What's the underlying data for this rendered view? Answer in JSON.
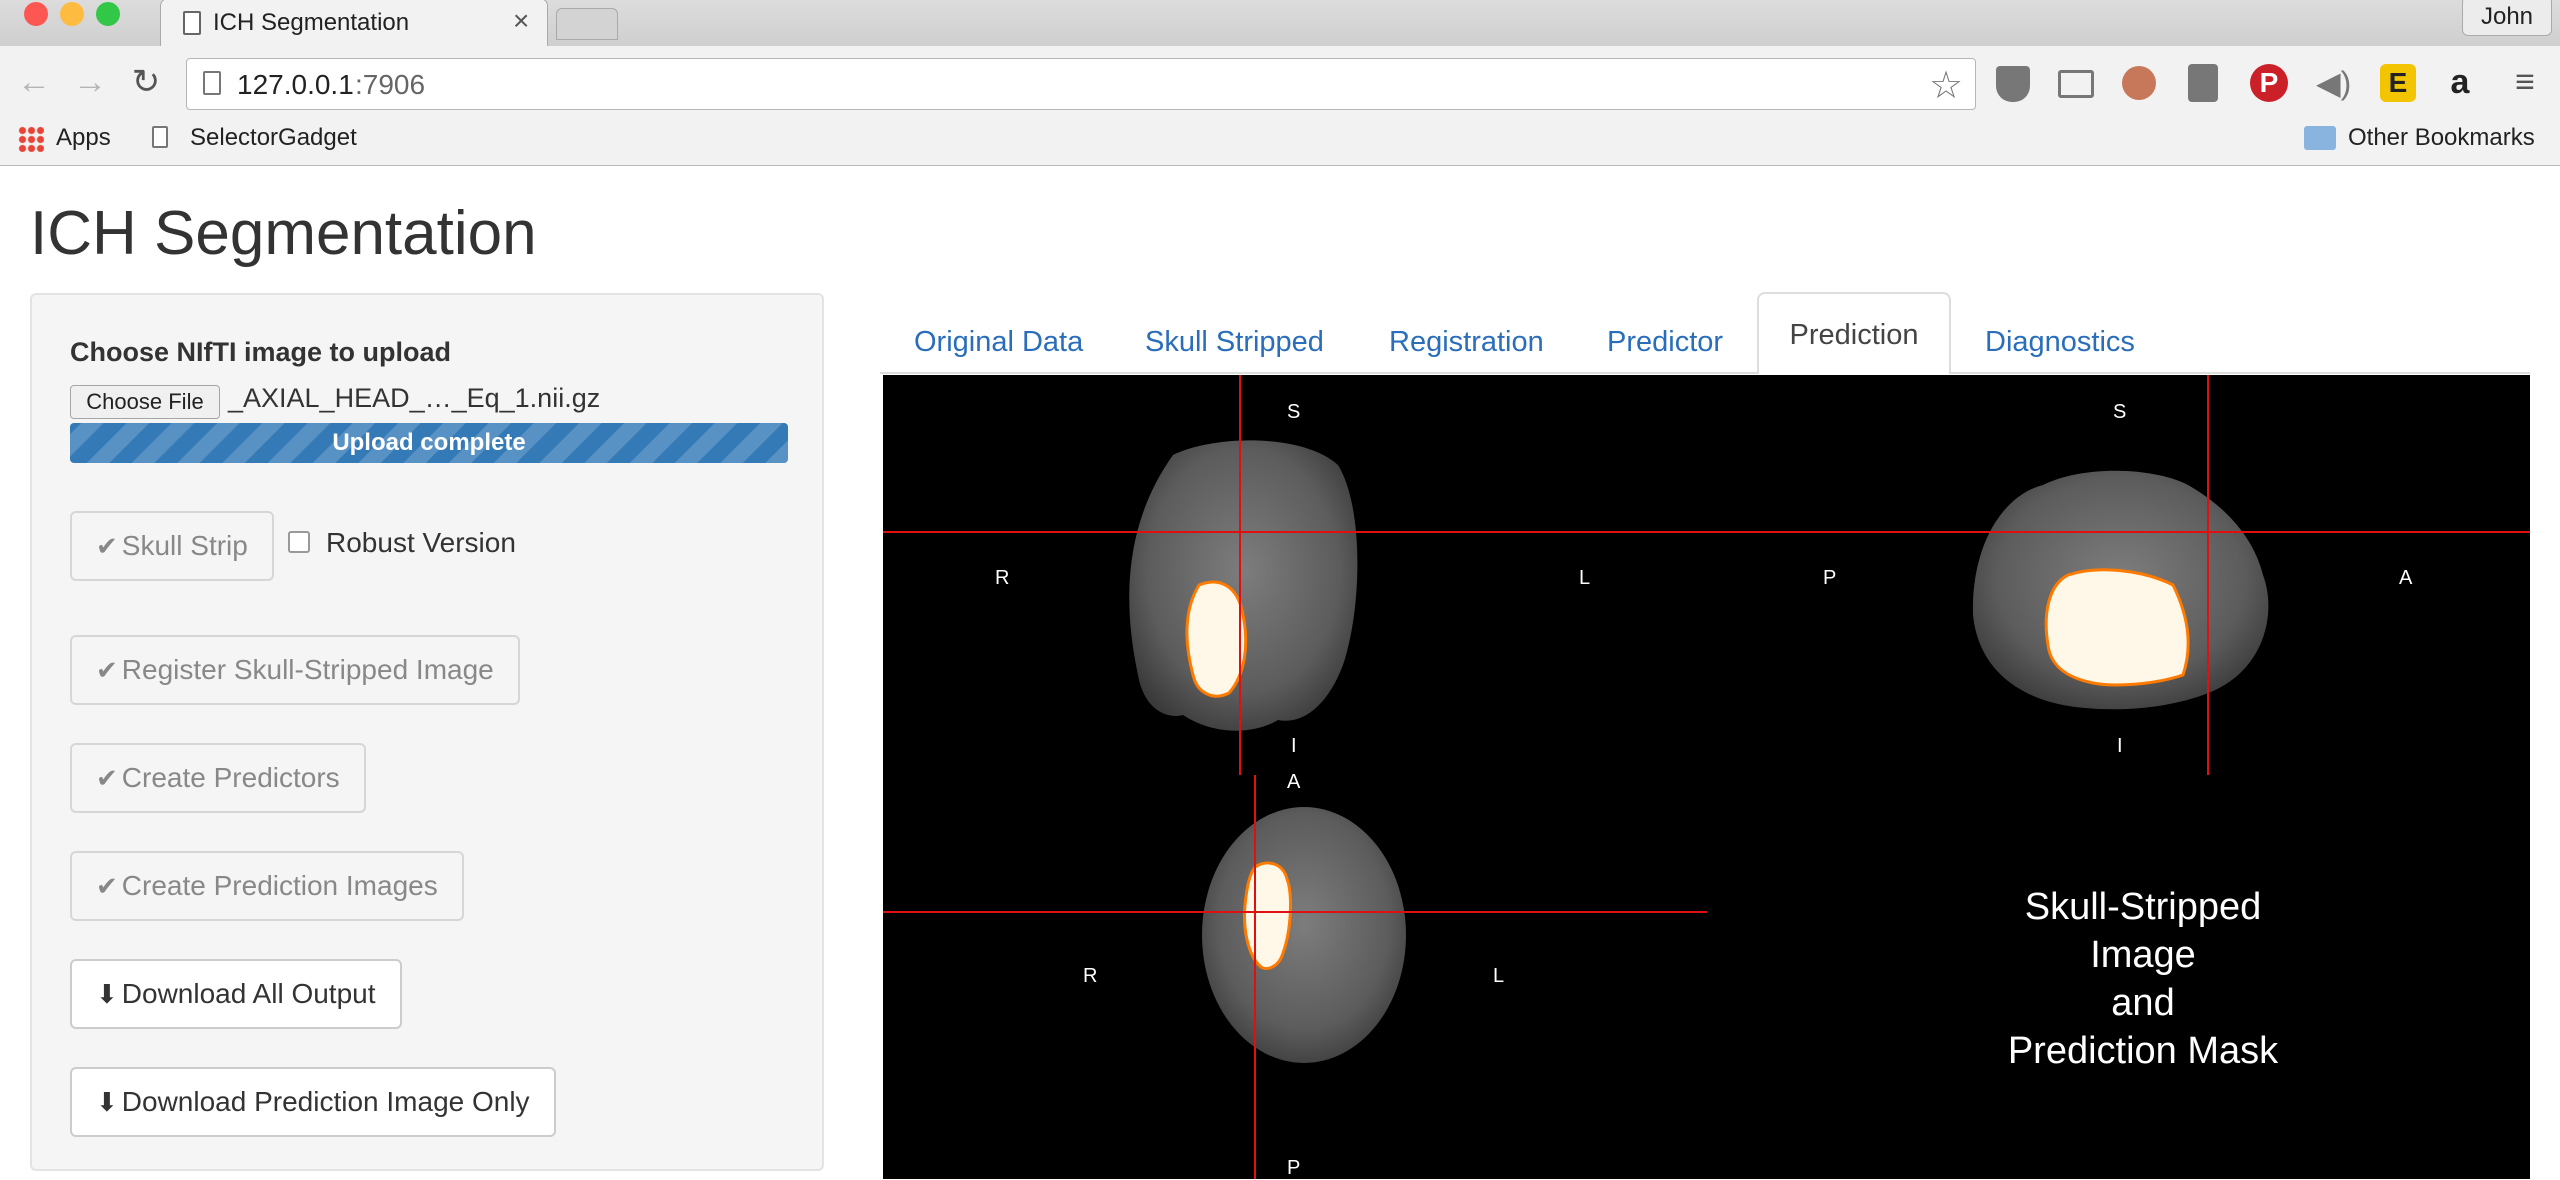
{
  "browser": {
    "tab_title": "ICH Segmentation",
    "tab_close": "×",
    "url_host": "127.0.0.1",
    "url_port": ":7906",
    "user_name": "John",
    "bookmarks": [
      {
        "label": "Apps"
      },
      {
        "label": "SelectorGadget"
      }
    ],
    "other_bookmarks": "Other Bookmarks",
    "traffic_colors": [
      "#fc5753",
      "#fdbc40",
      "#33c748"
    ]
  },
  "page": {
    "title": "ICH Segmentation"
  },
  "sidebar": {
    "upload_label": "Choose NIfTI image to upload",
    "choose_file_label": "Choose File",
    "file_name": "_AXIAL_HEAD_…_Eq_1.nii.gz",
    "upload_status": "Upload complete",
    "upload_progress": 1.0,
    "skull_strip_label": "Skull Strip",
    "robust_label": "Robust Version",
    "robust_checked": false,
    "register_label": "Register Skull-Stripped Image",
    "predictors_label": "Create Predictors",
    "prediction_images_label": "Create Prediction Images",
    "download_all_label": "Download All Output",
    "download_prediction_label": "Download Prediction Image Only"
  },
  "tabs": [
    {
      "label": "Original Data",
      "active": false
    },
    {
      "label": "Skull Stripped",
      "active": false
    },
    {
      "label": "Registration",
      "active": false
    },
    {
      "label": "Predictor",
      "active": false
    },
    {
      "label": "Prediction",
      "active": true
    },
    {
      "label": "Diagnostics",
      "active": false
    }
  ],
  "viewer": {
    "coronal": {
      "top": "S",
      "bottom": "I",
      "left": "R",
      "right": "L"
    },
    "sagittal": {
      "top": "S",
      "bottom": "I",
      "left": "P",
      "right": "A"
    },
    "axial": {
      "top": "A",
      "bottom": "P",
      "left": "R",
      "right": "L"
    },
    "caption_lines": [
      "Skull-Stripped",
      "Image",
      "and",
      "Prediction Mask"
    ]
  },
  "colors": {
    "link": "#2a6ebb",
    "progress": "#337ab7",
    "crosshair": "#e01010",
    "mask": "#fff8e8",
    "mask_edge": "#ff7a00"
  }
}
